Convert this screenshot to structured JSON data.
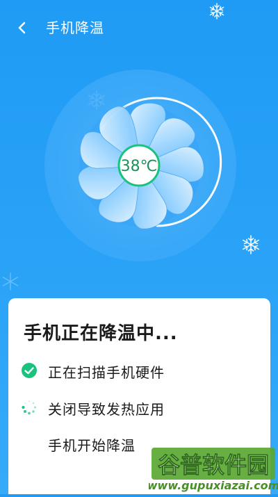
{
  "header": {
    "title": "手机降温"
  },
  "fan": {
    "temperature": "38℃"
  },
  "panel": {
    "title": "手机正在降温中...",
    "steps": [
      {
        "label": "正在扫描手机硬件",
        "status": "done"
      },
      {
        "label": "关闭导致发热应用",
        "status": "in-progress"
      },
      {
        "label": "手机开始降温",
        "status": "pending"
      }
    ]
  },
  "watermark": {
    "brand": "谷普软件园",
    "url": "www.gupuxiazai.com"
  },
  "colors": {
    "background": "#1f9bf5",
    "accent_green": "#19c37d",
    "fan_blue": "#5fb8fb"
  }
}
